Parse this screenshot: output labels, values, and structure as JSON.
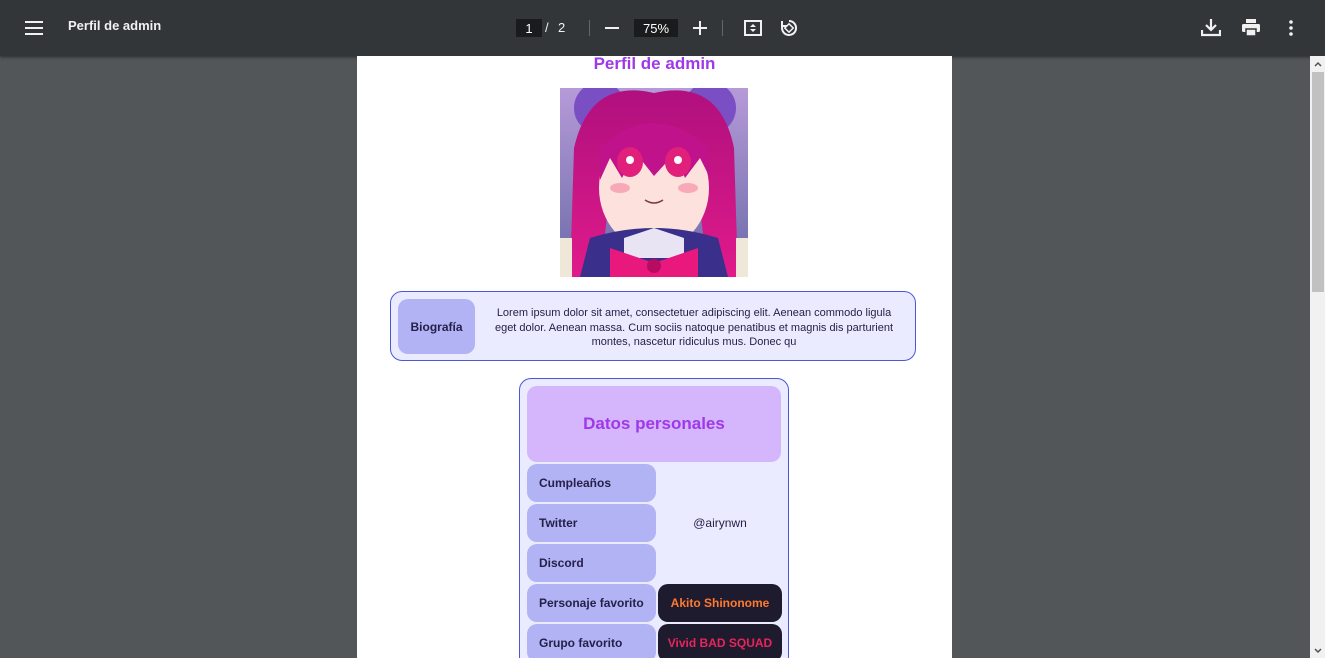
{
  "toolbar": {
    "title": "Perfil de admin",
    "current_page": "1",
    "page_separator": "/",
    "total_pages": "2",
    "zoom": "75%",
    "icons": [
      "menu-icon",
      "zoom-out-icon",
      "zoom-in-icon",
      "fit-page-icon",
      "rotate-icon",
      "download-icon",
      "print-icon",
      "more-icon"
    ]
  },
  "document": {
    "title": "Perfil de admin",
    "bio": {
      "label": "Biografía",
      "text": "Lorem ipsum dolor sit amet, consectetuer adipiscing elit. Aenean commodo ligula eget dolor. Aenean massa. Cum sociis natoque penatibus et magnis dis parturient montes, nascetur ridiculus mus. Donec qu"
    },
    "personal": {
      "header": "Datos personales",
      "rows": [
        {
          "label": "Cumpleaños",
          "value": ""
        },
        {
          "label": "Twitter",
          "value": "@airynwn"
        },
        {
          "label": "Discord",
          "value": ""
        },
        {
          "label": "Personaje favorito",
          "value": "Akito Shinonome",
          "value_color": "#ff7a2e"
        },
        {
          "label": "Grupo favorito",
          "value": "Vivid BAD SQUAD",
          "value_color": "#e8245c"
        }
      ]
    }
  },
  "colors": {
    "accent": "#9e38e8",
    "label_bg": "#b1b3f5",
    "box_border": "#4a58d8",
    "header_bg": "#d5b5fc"
  }
}
